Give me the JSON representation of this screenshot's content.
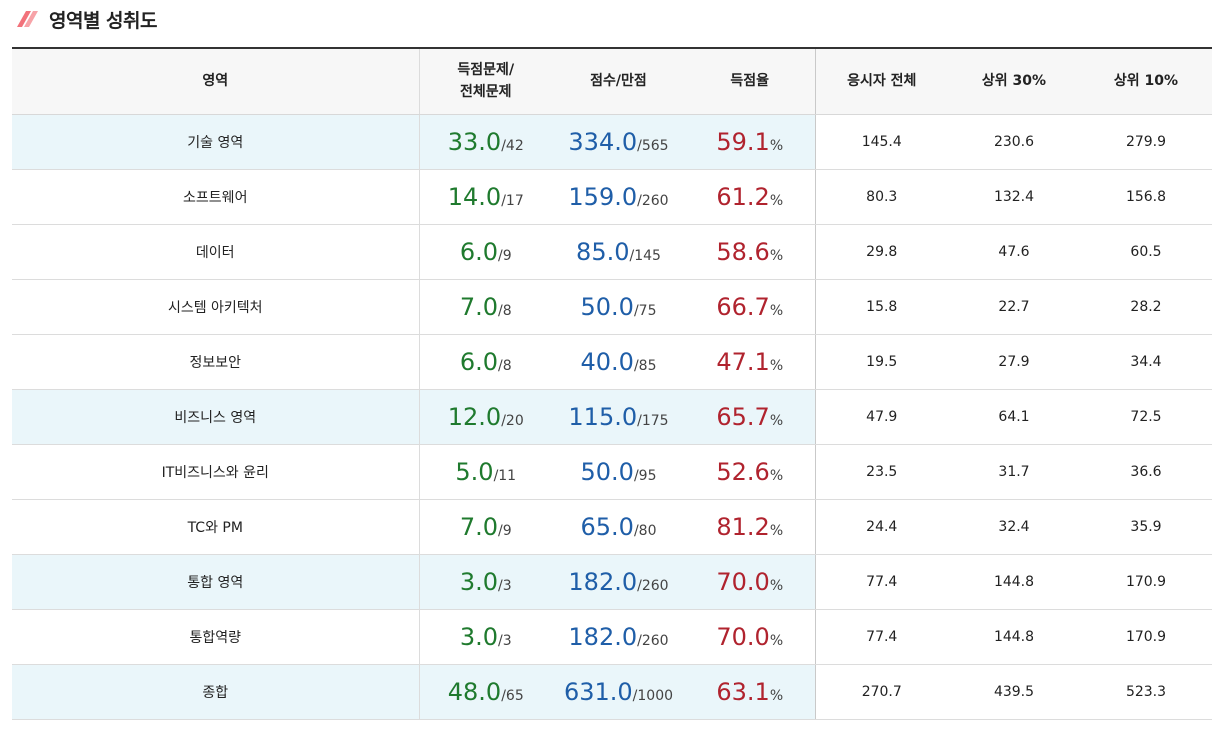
{
  "section": {
    "title": "영역별 성취도",
    "icon": "slash-accent-icon",
    "accent_color": "#f2727b"
  },
  "colors": {
    "highlight_bg": "#eaf6fa",
    "green": "#1f7a2e",
    "blue": "#1f5ea8",
    "red": "#b0232e"
  },
  "table": {
    "headers": {
      "area": "영역",
      "correct_line1": "득점문제/",
      "correct_line2": "전체문제",
      "score": "점수/만점",
      "rate": "득점율",
      "all": "응시자 전체",
      "top30": "상위 30%",
      "top10": "상위 10%"
    },
    "rows": [
      {
        "area": "기술 영역",
        "highlight": true,
        "correct": "33.0",
        "total_q": "/42",
        "score": "334.0",
        "max": "/565",
        "rate": "59.1",
        "pct": "%",
        "all": "145.4",
        "top30": "230.6",
        "top10": "279.9"
      },
      {
        "area": "소프트웨어",
        "highlight": false,
        "correct": "14.0",
        "total_q": "/17",
        "score": "159.0",
        "max": "/260",
        "rate": "61.2",
        "pct": "%",
        "all": "80.3",
        "top30": "132.4",
        "top10": "156.8"
      },
      {
        "area": "데이터",
        "highlight": false,
        "correct": "6.0",
        "total_q": "/9",
        "score": "85.0",
        "max": "/145",
        "rate": "58.6",
        "pct": "%",
        "all": "29.8",
        "top30": "47.6",
        "top10": "60.5"
      },
      {
        "area": "시스템 아키텍처",
        "highlight": false,
        "correct": "7.0",
        "total_q": "/8",
        "score": "50.0",
        "max": "/75",
        "rate": "66.7",
        "pct": "%",
        "all": "15.8",
        "top30": "22.7",
        "top10": "28.2"
      },
      {
        "area": "정보보안",
        "highlight": false,
        "correct": "6.0",
        "total_q": "/8",
        "score": "40.0",
        "max": "/85",
        "rate": "47.1",
        "pct": "%",
        "all": "19.5",
        "top30": "27.9",
        "top10": "34.4"
      },
      {
        "area": "비즈니스 영역",
        "highlight": true,
        "correct": "12.0",
        "total_q": "/20",
        "score": "115.0",
        "max": "/175",
        "rate": "65.7",
        "pct": "%",
        "all": "47.9",
        "top30": "64.1",
        "top10": "72.5"
      },
      {
        "area": "IT비즈니스와 윤리",
        "highlight": false,
        "correct": "5.0",
        "total_q": "/11",
        "score": "50.0",
        "max": "/95",
        "rate": "52.6",
        "pct": "%",
        "all": "23.5",
        "top30": "31.7",
        "top10": "36.6"
      },
      {
        "area": "TC와 PM",
        "highlight": false,
        "correct": "7.0",
        "total_q": "/9",
        "score": "65.0",
        "max": "/80",
        "rate": "81.2",
        "pct": "%",
        "all": "24.4",
        "top30": "32.4",
        "top10": "35.9"
      },
      {
        "area": "통합 영역",
        "highlight": true,
        "correct": "3.0",
        "total_q": "/3",
        "score": "182.0",
        "max": "/260",
        "rate": "70.0",
        "pct": "%",
        "all": "77.4",
        "top30": "144.8",
        "top10": "170.9"
      },
      {
        "area": "통합역량",
        "highlight": false,
        "correct": "3.0",
        "total_q": "/3",
        "score": "182.0",
        "max": "/260",
        "rate": "70.0",
        "pct": "%",
        "all": "77.4",
        "top30": "144.8",
        "top10": "170.9"
      },
      {
        "area": "종합",
        "highlight": true,
        "correct": "48.0",
        "total_q": "/65",
        "score": "631.0",
        "max": "/1000",
        "rate": "63.1",
        "pct": "%",
        "all": "270.7",
        "top30": "439.5",
        "top10": "523.3"
      }
    ]
  }
}
